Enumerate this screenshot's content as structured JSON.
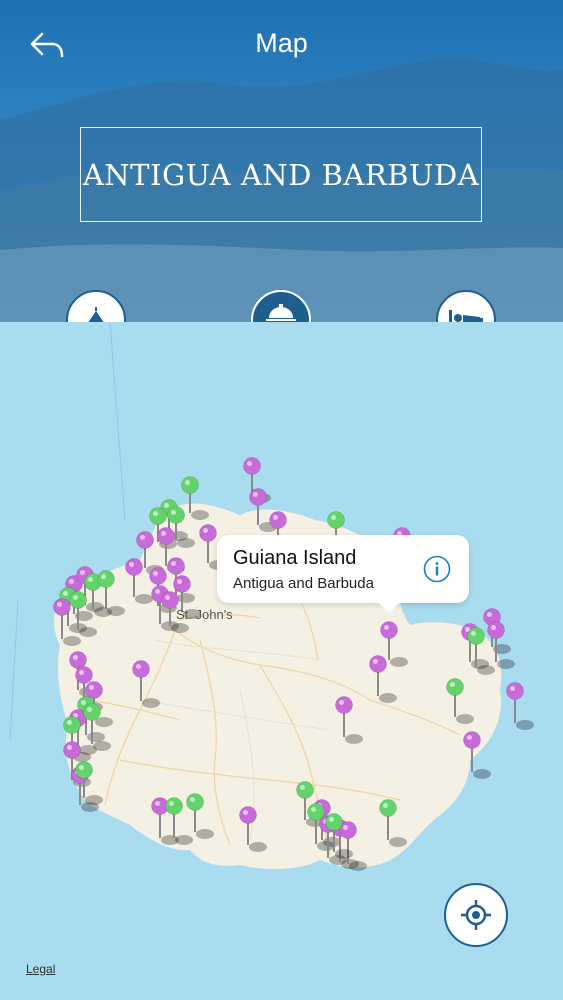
{
  "header": {
    "title": "Map",
    "banner": "ANTIGUA AND BARBUDA"
  },
  "category_buttons": [
    {
      "icon": "tent-icon",
      "active": false
    },
    {
      "icon": "hotel-bell-icon",
      "active": true
    },
    {
      "icon": "bed-icon",
      "active": false
    }
  ],
  "map": {
    "place_label": "St. John's",
    "callout": {
      "title": "Guiana Island",
      "subtitle": "Antigua and Barbuda"
    },
    "legal_label": "Legal"
  },
  "colors": {
    "accent": "#1e5f8f",
    "water": "#aadcf0",
    "land": "#f4f1e4",
    "pin_purple": "#c86ad9",
    "pin_green": "#63d36b"
  }
}
